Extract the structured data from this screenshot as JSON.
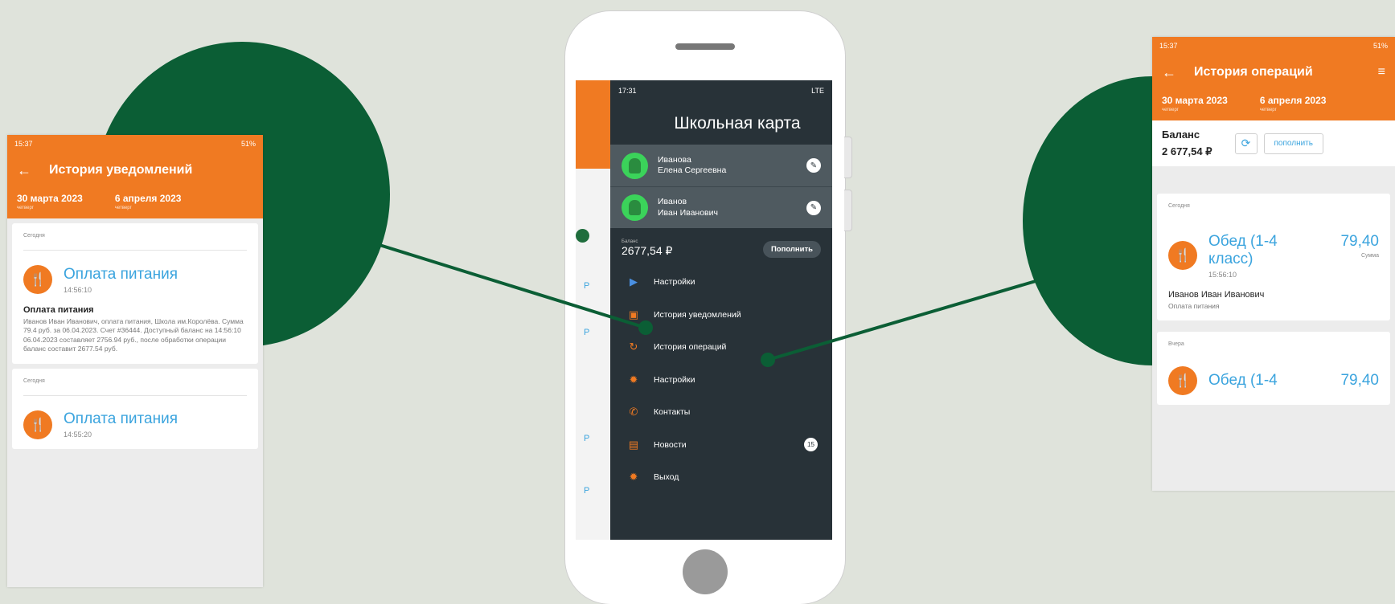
{
  "left_screen": {
    "status_time": "15:37",
    "status_right": "51%",
    "title": "История уведомлений",
    "date_from": "30 марта 2023",
    "date_from_day": "четверг",
    "date_to": "6 апреля 2023",
    "date_to_day": "четверг",
    "cards": [
      {
        "section": "Сегодня",
        "title": "Оплата питания",
        "time": "14:56:10",
        "msg_title": "Оплата питания",
        "msg_body": "Иванов Иван Иванович, оплата питания, Школа им.Королёва. Сумма 79.4 руб. за 06.04.2023. Счет #36444. Доступный баланс на 14:56:10 06.04.2023 составляет 2756.94 руб., после обработки операции баланс составит 2677.54 руб."
      },
      {
        "section": "Сегодня",
        "title": "Оплата питания",
        "time": "14:55:20"
      }
    ]
  },
  "phone": {
    "status_time": "17:31",
    "status_net": "LTE",
    "drawer_title": "Школьная карта",
    "accounts": [
      {
        "line1": "Иванова",
        "line2": "Елена Сергеевна"
      },
      {
        "line1": "Иванов",
        "line2": "Иван Иванович"
      }
    ],
    "balance_label": "Баланс",
    "balance_value": "2677,54 ₽",
    "topup_label": "Пополнить",
    "menu": [
      {
        "icon": "settings-icon",
        "label": "Настройки"
      },
      {
        "icon": "notification-history-icon",
        "label": "История уведомлений"
      },
      {
        "icon": "operations-history-icon",
        "label": "История операций"
      },
      {
        "icon": "gear-icon",
        "label": "Настройки"
      },
      {
        "icon": "phone-icon",
        "label": "Контакты"
      },
      {
        "icon": "news-icon",
        "label": "Новости",
        "badge": "15"
      },
      {
        "icon": "exit-icon",
        "label": "Выход"
      }
    ],
    "strip_labels": [
      "Р",
      "Р",
      "Р",
      "Р"
    ]
  },
  "right_screen": {
    "status_time": "15:37",
    "status_right": "51%",
    "title": "История операций",
    "date_from": "30 марта 2023",
    "date_from_day": "четверг",
    "date_to": "6 апреля 2023",
    "date_to_day": "четверг",
    "balance_label": "Баланс",
    "balance_value": "2 677,54 ₽",
    "topup_label": "пополнить",
    "ops": [
      {
        "section": "Сегодня",
        "title_line1": "Обед (1-4",
        "title_line2": "класс)",
        "time": "15:56:10",
        "amount": "79,40",
        "amount_label": "Сумма",
        "person": "Иванов Иван Иванович",
        "purpose": "Оплата питания"
      },
      {
        "section": "Вчера",
        "title_line1": "Обед (1-4",
        "amount": "79,40"
      }
    ]
  },
  "colors": {
    "accent": "#f07a22",
    "drawer": "#283238",
    "green": "#0b5e35",
    "link": "#3ba4de"
  }
}
